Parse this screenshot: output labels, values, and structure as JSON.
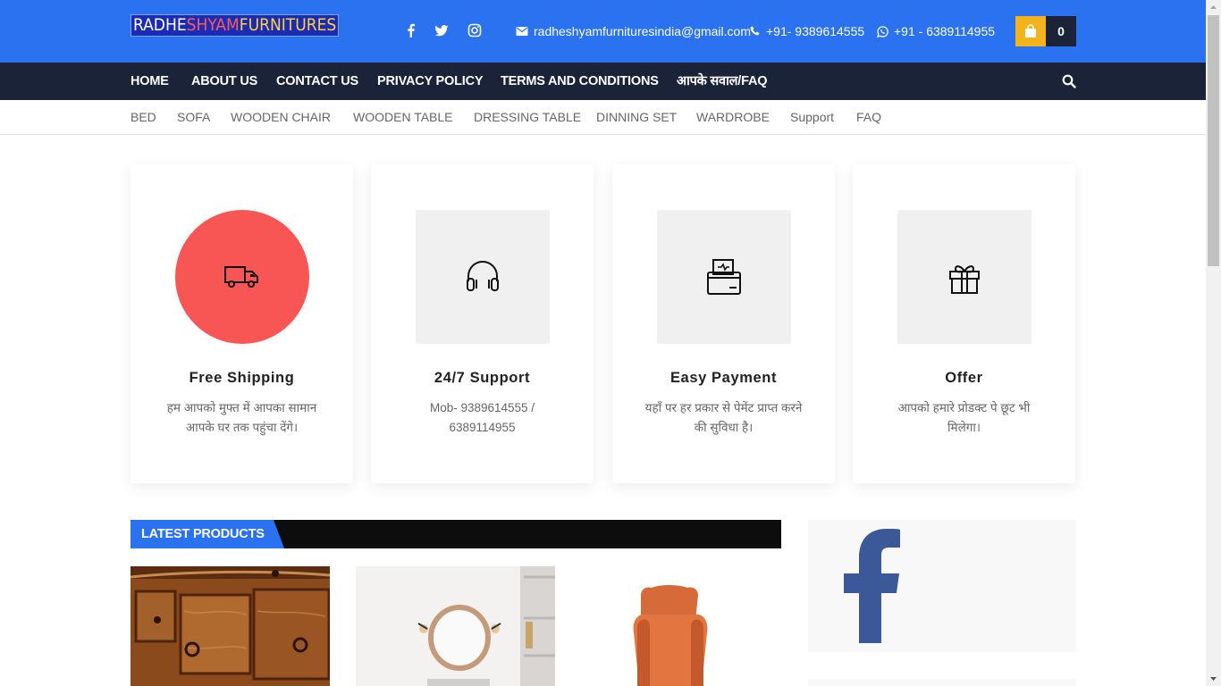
{
  "header": {
    "logo": {
      "part1": "RADHE",
      "part2": "SHYAM",
      "part3": "FURNITURES"
    },
    "social": [
      "facebook-icon",
      "twitter-icon",
      "instagram-icon"
    ],
    "email": "radheshyamfurnituresindia@gmail.com",
    "phone": "+91- 9389614555",
    "whatsapp": "+91 - 6389114955",
    "cart_count": "0"
  },
  "main_nav": {
    "items": [
      "HOME",
      "ABOUT US",
      "CONTACT US",
      "PRIVACY POLICY",
      "TERMS AND CONDITIONS",
      "आपके सवाल/FAQ"
    ]
  },
  "category_nav": {
    "items": [
      "BED",
      "SOFA",
      "WOODEN CHAIR",
      "WOODEN TABLE",
      "DRESSING TABLE",
      "DINNING SET",
      "WARDROBE",
      "Support",
      "FAQ"
    ]
  },
  "features": [
    {
      "title": "Free Shipping",
      "desc": "हम आपको मुफ्त में आपका सामान आपके घर तक पहुंचा देंगे।",
      "icon": "truck-icon"
    },
    {
      "title": "24/7 Support",
      "desc": "Mob- 9389614555 / 6389114955",
      "icon": "headphones-icon"
    },
    {
      "title": "Easy Payment",
      "desc": "यहाँ पर हर प्रकार से पेमेंट प्राप्त करने की सुविधा है।",
      "icon": "payment-icon"
    },
    {
      "title": "Offer",
      "desc": "आपको हमारे प्रोडक्ट पे छूट भी मिलेगा।",
      "icon": "gift-icon"
    }
  ],
  "latest_products": {
    "heading": "LATEST PRODUCTS",
    "items": [
      "wooden-drawer-cabinet-image",
      "round-mirror-dressing-image",
      "orange-wing-chair-image"
    ]
  },
  "colors": {
    "brand_blue": "#2a72f0",
    "nav_dark": "#1a2337",
    "accent_red": "#f75655",
    "cart_yellow": "#f5b31b"
  }
}
